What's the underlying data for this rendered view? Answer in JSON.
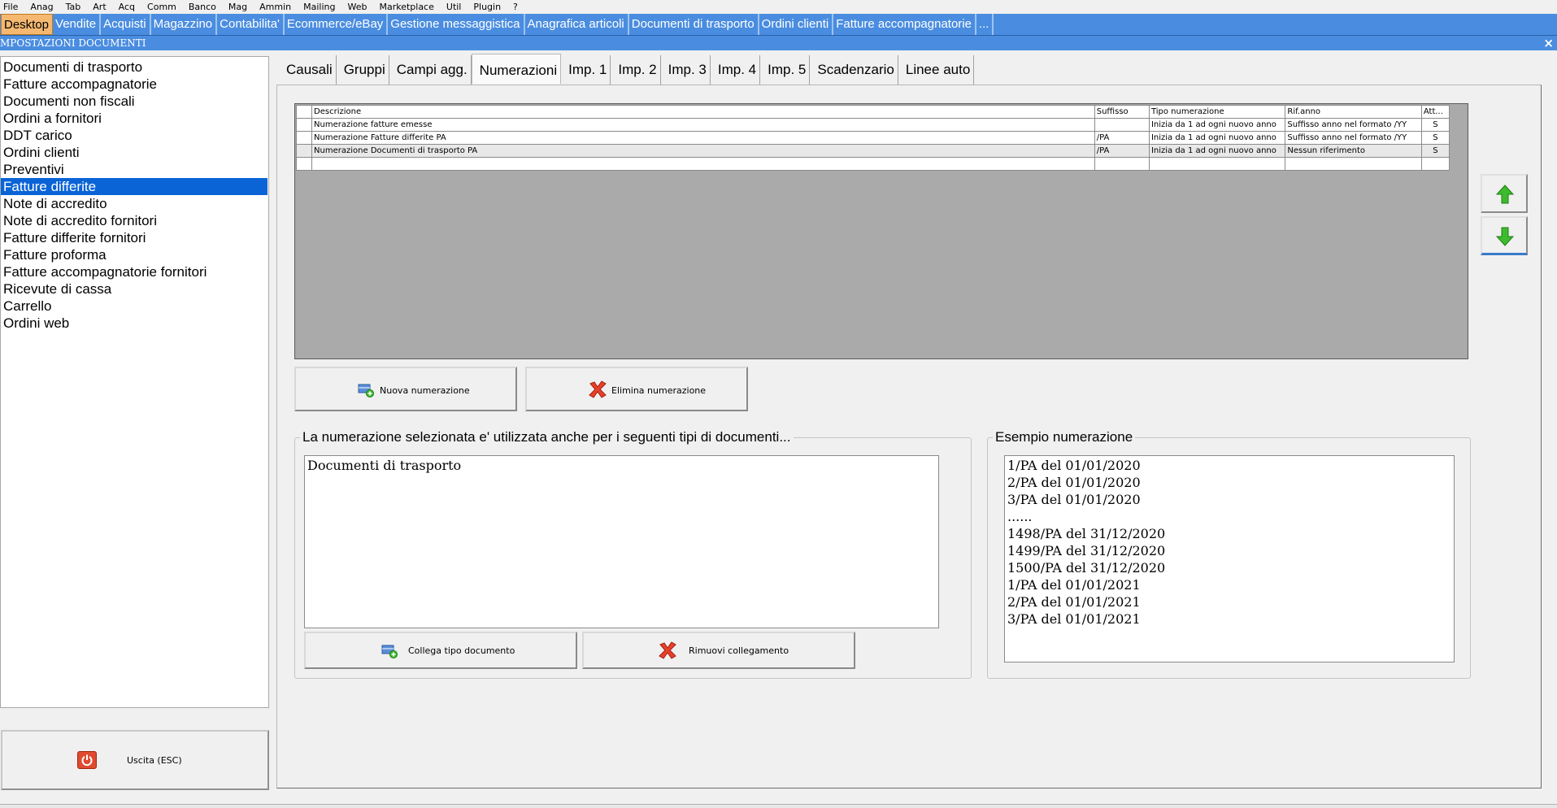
{
  "menubar": [
    "File",
    "Anag",
    "Tab",
    "Art",
    "Acq",
    "Comm",
    "Banco",
    "Mag",
    "Ammin",
    "Mailing",
    "Web",
    "Marketplace",
    "Util",
    "Plugin",
    "?"
  ],
  "app_tabs": [
    "Desktop",
    "Vendite",
    "Acquisti",
    "Magazzino",
    "Contabilita'",
    "Ecommerce/eBay",
    "Gestione messaggistica",
    "Anagrafica articoli",
    "Documenti di trasporto",
    "Ordini clienti",
    "Fatture accompagnatorie",
    "..."
  ],
  "window": {
    "title": "MPOSTAZIONI DOCUMENTI",
    "close": "×"
  },
  "document_types": [
    "Documenti di trasporto",
    "Fatture accompagnatorie",
    "Documenti non fiscali",
    "Ordini a fornitori",
    "DDT carico",
    "Ordini clienti",
    "Preventivi",
    "Fatture differite",
    "Note di accredito",
    "Note di accredito fornitori",
    "Fatture differite fornitori",
    "Fatture proforma",
    "Fatture accompagnatorie fornitori",
    "Ricevute di cassa",
    "Carrello",
    "Ordini web"
  ],
  "selected_document_type": "Fatture differite",
  "exit_button": "Uscita (ESC)",
  "content_tabs": [
    "Causali",
    "Gruppi",
    "Campi agg.",
    "Numerazioni",
    "Imp. 1",
    "Imp. 2",
    "Imp. 3",
    "Imp. 4",
    "Imp. 5",
    "Scadenzario",
    "Linee auto"
  ],
  "active_content_tab": "Numerazioni",
  "grid": {
    "headers": [
      "Descrizione",
      "Suffisso",
      "Tipo numerazione",
      "Rif.anno",
      "Att..."
    ],
    "rows": [
      [
        "Numerazione fatture emesse",
        "",
        "Inizia da 1 ad ogni nuovo anno",
        "Suffisso anno nel formato /YY",
        "S"
      ],
      [
        "Numerazione Fatture differite PA",
        "/PA",
        "Inizia da 1 ad ogni nuovo anno",
        "Suffisso anno nel formato /YY",
        "S"
      ],
      [
        "Numerazione Documenti di trasporto PA",
        "/PA",
        "Inizia da 1 ad ogni nuovo anno",
        "Nessun riferimento",
        "S"
      ]
    ],
    "selected_row": 2
  },
  "buttons": {
    "new_numbering": "Nuova numerazione",
    "delete_numbering": "Elimina numerazione",
    "link_doc_type": "Collega tipo documento",
    "remove_link": "Rimuovi collegamento"
  },
  "linked_docs": {
    "legend": "La numerazione selezionata e' utilizzata anche per i seguenti tipi di documenti...",
    "items": [
      "Documenti di trasporto"
    ]
  },
  "example": {
    "legend": "Esempio numerazione",
    "lines": [
      "1/PA del 01/01/2020",
      "2/PA del 01/01/2020",
      "3/PA del 01/01/2020",
      "......",
      "1498/PA del 31/12/2020",
      "1499/PA del 31/12/2020",
      "1500/PA del 31/12/2020",
      "1/PA del 01/01/2021",
      "2/PA del 01/01/2021",
      "3/PA del 01/01/2021"
    ]
  },
  "colors": {
    "title_blue": "#4a8de0",
    "selection_blue": "#0a64d6",
    "active_tab_orange": "#f4b870",
    "arrow_green": "#3cbc2c",
    "delete_red": "#e8402a"
  }
}
